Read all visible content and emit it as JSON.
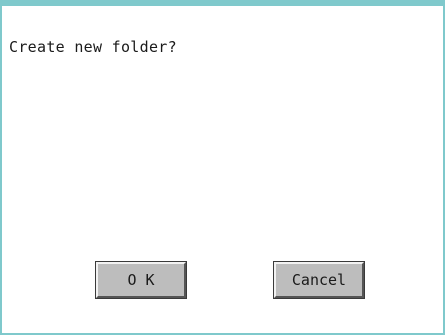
{
  "dialog": {
    "message": "Create new folder?",
    "ok_label": "O K",
    "cancel_label": "Cancel",
    "accent_color": "#7fc9cc",
    "button_color": "#bdbdbd"
  }
}
